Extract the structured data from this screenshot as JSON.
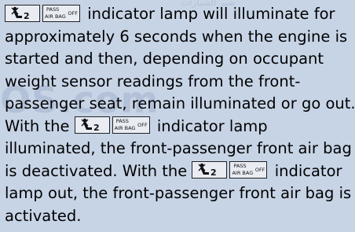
{
  "watermark": {
    "brand": "OS.com",
    "top_text": "شير السيارات"
  },
  "icon": {
    "person": "seat-occupant-airbag-icon",
    "pass_top": "PASS",
    "pass_bottom": "AIR BAG",
    "pass_off": "OFF"
  },
  "paragraph": {
    "line1_after_icons": "indicator lamp will illuminate for",
    "line2": "approximately 6 seconds when the engine is",
    "line3": "started and then, depending on occupant",
    "line4": "weight sensor readings from the front-",
    "line5": "passenger seat, remain illuminated or go out.",
    "line6_before_icons": "With the",
    "line6_after_icons": "indicator lamp",
    "line7": "illuminated, the front-passenger front air bag",
    "line8_before_icons": "is deactivated. With the",
    "line8_after_icons": "indicator",
    "line9": "lamp out, the front-passenger front air bag is",
    "line10": "activated."
  }
}
